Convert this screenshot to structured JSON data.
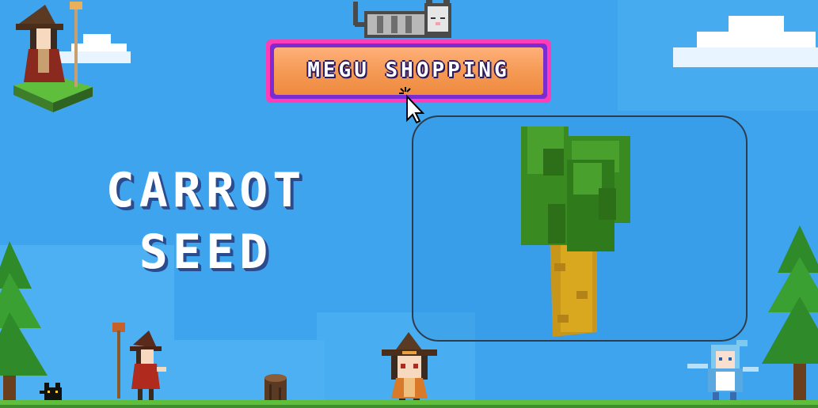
{
  "title_button": {
    "label": "MEGU SHOPPING"
  },
  "product": {
    "name_line1": "CARROT",
    "name_line2": "SEED",
    "icon": "carrot-seed-icon"
  },
  "sprites": {
    "cat": "sleeping-cat-icon",
    "witch_top_left": "witch-on-island-icon",
    "witch_walking": "witch-with-staff-icon",
    "witch_center": "chibi-witch-icon",
    "priestess": "blue-haired-priestess-icon",
    "black_cat": "black-cat-icon",
    "stump": "tree-stump-icon",
    "tree_left": "pine-tree-icon",
    "tree_right": "pine-tree-icon",
    "cursor": "mouse-cursor-icon"
  },
  "colors": {
    "sky": "#3fa4ee",
    "button_outer": "#ff3db8",
    "button_inner": "#f59a55",
    "carrot_body": "#d9a81e",
    "carrot_leaves": "#3a8a22"
  }
}
